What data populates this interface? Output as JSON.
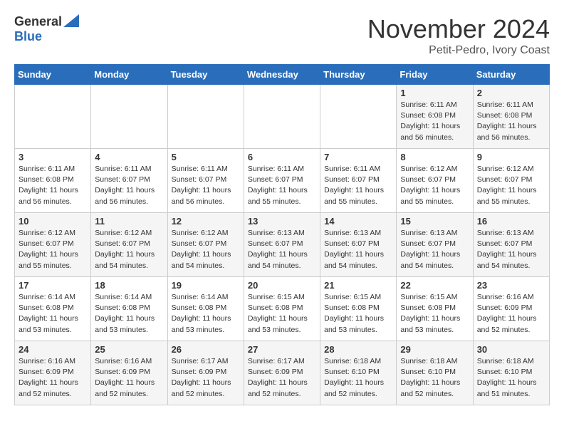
{
  "header": {
    "logo_line1": "General",
    "logo_line2": "Blue",
    "month": "November 2024",
    "location": "Petit-Pedro, Ivory Coast"
  },
  "weekdays": [
    "Sunday",
    "Monday",
    "Tuesday",
    "Wednesday",
    "Thursday",
    "Friday",
    "Saturday"
  ],
  "weeks": [
    [
      {
        "day": "",
        "info": ""
      },
      {
        "day": "",
        "info": ""
      },
      {
        "day": "",
        "info": ""
      },
      {
        "day": "",
        "info": ""
      },
      {
        "day": "",
        "info": ""
      },
      {
        "day": "1",
        "info": "Sunrise: 6:11 AM\nSunset: 6:08 PM\nDaylight: 11 hours\nand 56 minutes."
      },
      {
        "day": "2",
        "info": "Sunrise: 6:11 AM\nSunset: 6:08 PM\nDaylight: 11 hours\nand 56 minutes."
      }
    ],
    [
      {
        "day": "3",
        "info": "Sunrise: 6:11 AM\nSunset: 6:08 PM\nDaylight: 11 hours\nand 56 minutes."
      },
      {
        "day": "4",
        "info": "Sunrise: 6:11 AM\nSunset: 6:07 PM\nDaylight: 11 hours\nand 56 minutes."
      },
      {
        "day": "5",
        "info": "Sunrise: 6:11 AM\nSunset: 6:07 PM\nDaylight: 11 hours\nand 56 minutes."
      },
      {
        "day": "6",
        "info": "Sunrise: 6:11 AM\nSunset: 6:07 PM\nDaylight: 11 hours\nand 55 minutes."
      },
      {
        "day": "7",
        "info": "Sunrise: 6:11 AM\nSunset: 6:07 PM\nDaylight: 11 hours\nand 55 minutes."
      },
      {
        "day": "8",
        "info": "Sunrise: 6:12 AM\nSunset: 6:07 PM\nDaylight: 11 hours\nand 55 minutes."
      },
      {
        "day": "9",
        "info": "Sunrise: 6:12 AM\nSunset: 6:07 PM\nDaylight: 11 hours\nand 55 minutes."
      }
    ],
    [
      {
        "day": "10",
        "info": "Sunrise: 6:12 AM\nSunset: 6:07 PM\nDaylight: 11 hours\nand 55 minutes."
      },
      {
        "day": "11",
        "info": "Sunrise: 6:12 AM\nSunset: 6:07 PM\nDaylight: 11 hours\nand 54 minutes."
      },
      {
        "day": "12",
        "info": "Sunrise: 6:12 AM\nSunset: 6:07 PM\nDaylight: 11 hours\nand 54 minutes."
      },
      {
        "day": "13",
        "info": "Sunrise: 6:13 AM\nSunset: 6:07 PM\nDaylight: 11 hours\nand 54 minutes."
      },
      {
        "day": "14",
        "info": "Sunrise: 6:13 AM\nSunset: 6:07 PM\nDaylight: 11 hours\nand 54 minutes."
      },
      {
        "day": "15",
        "info": "Sunrise: 6:13 AM\nSunset: 6:07 PM\nDaylight: 11 hours\nand 54 minutes."
      },
      {
        "day": "16",
        "info": "Sunrise: 6:13 AM\nSunset: 6:07 PM\nDaylight: 11 hours\nand 54 minutes."
      }
    ],
    [
      {
        "day": "17",
        "info": "Sunrise: 6:14 AM\nSunset: 6:08 PM\nDaylight: 11 hours\nand 53 minutes."
      },
      {
        "day": "18",
        "info": "Sunrise: 6:14 AM\nSunset: 6:08 PM\nDaylight: 11 hours\nand 53 minutes."
      },
      {
        "day": "19",
        "info": "Sunrise: 6:14 AM\nSunset: 6:08 PM\nDaylight: 11 hours\nand 53 minutes."
      },
      {
        "day": "20",
        "info": "Sunrise: 6:15 AM\nSunset: 6:08 PM\nDaylight: 11 hours\nand 53 minutes."
      },
      {
        "day": "21",
        "info": "Sunrise: 6:15 AM\nSunset: 6:08 PM\nDaylight: 11 hours\nand 53 minutes."
      },
      {
        "day": "22",
        "info": "Sunrise: 6:15 AM\nSunset: 6:08 PM\nDaylight: 11 hours\nand 53 minutes."
      },
      {
        "day": "23",
        "info": "Sunrise: 6:16 AM\nSunset: 6:09 PM\nDaylight: 11 hours\nand 52 minutes."
      }
    ],
    [
      {
        "day": "24",
        "info": "Sunrise: 6:16 AM\nSunset: 6:09 PM\nDaylight: 11 hours\nand 52 minutes."
      },
      {
        "day": "25",
        "info": "Sunrise: 6:16 AM\nSunset: 6:09 PM\nDaylight: 11 hours\nand 52 minutes."
      },
      {
        "day": "26",
        "info": "Sunrise: 6:17 AM\nSunset: 6:09 PM\nDaylight: 11 hours\nand 52 minutes."
      },
      {
        "day": "27",
        "info": "Sunrise: 6:17 AM\nSunset: 6:09 PM\nDaylight: 11 hours\nand 52 minutes."
      },
      {
        "day": "28",
        "info": "Sunrise: 6:18 AM\nSunset: 6:10 PM\nDaylight: 11 hours\nand 52 minutes."
      },
      {
        "day": "29",
        "info": "Sunrise: 6:18 AM\nSunset: 6:10 PM\nDaylight: 11 hours\nand 52 minutes."
      },
      {
        "day": "30",
        "info": "Sunrise: 6:18 AM\nSunset: 6:10 PM\nDaylight: 11 hours\nand 51 minutes."
      }
    ]
  ]
}
